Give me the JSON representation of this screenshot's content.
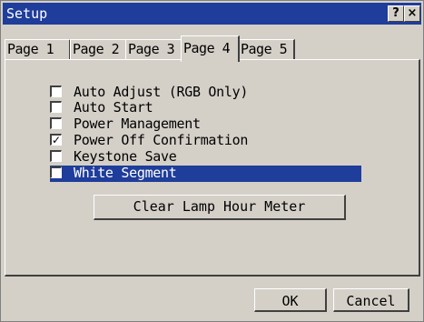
{
  "window": {
    "title": "Setup",
    "help_label": "?",
    "close_label": "×"
  },
  "tabs": [
    {
      "label": "Page 1"
    },
    {
      "label": "Page 2"
    },
    {
      "label": "Page 3"
    },
    {
      "label": "Page 4",
      "active": true
    },
    {
      "label": "Page 5"
    }
  ],
  "options": [
    {
      "label": "Auto Adjust (RGB Only)",
      "checked": false
    },
    {
      "label": "Auto Start",
      "checked": false
    },
    {
      "label": "Power Management",
      "checked": false
    },
    {
      "label": "Power Off Confirmation",
      "checked": true
    },
    {
      "label": "Keystone Save",
      "checked": false
    },
    {
      "label": "White Segment",
      "checked": false,
      "highlighted": true
    }
  ],
  "checkmark": "✓",
  "actions": {
    "clear_lamp_label": "Clear Lamp Hour Meter",
    "ok_label": "OK",
    "cancel_label": "Cancel"
  },
  "colors": {
    "titlebar": "#1f3d9a",
    "dialog_bg": "#d4d0c8",
    "highlight": "#1f3d9a"
  }
}
